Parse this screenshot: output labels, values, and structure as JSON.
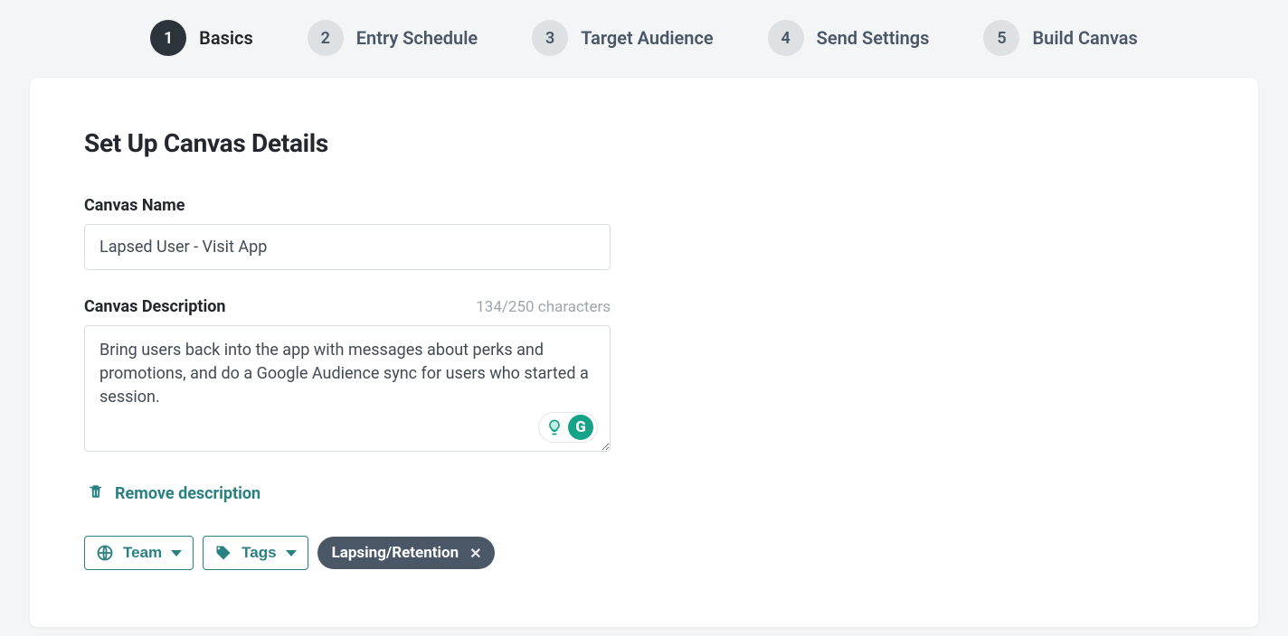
{
  "stepper": [
    {
      "num": "1",
      "label": "Basics",
      "active": true
    },
    {
      "num": "2",
      "label": "Entry Schedule",
      "active": false
    },
    {
      "num": "3",
      "label": "Target Audience",
      "active": false
    },
    {
      "num": "4",
      "label": "Send Settings",
      "active": false
    },
    {
      "num": "5",
      "label": "Build Canvas",
      "active": false
    }
  ],
  "page": {
    "title": "Set Up Canvas Details"
  },
  "form": {
    "name_label": "Canvas Name",
    "name_value": "Lapsed User - Visit App",
    "desc_label": "Canvas Description",
    "desc_char_count": "134/250 characters",
    "desc_value": "Bring users back into the app with messages about perks and promotions, and do a Google Audience sync for users who started a session.",
    "remove_desc_label": "Remove description"
  },
  "dropdowns": {
    "team_label": "Team",
    "tags_label": "Tags"
  },
  "tags": [
    {
      "label": "Lapsing/Retention"
    }
  ],
  "colors": {
    "teal": "#2b8182"
  }
}
